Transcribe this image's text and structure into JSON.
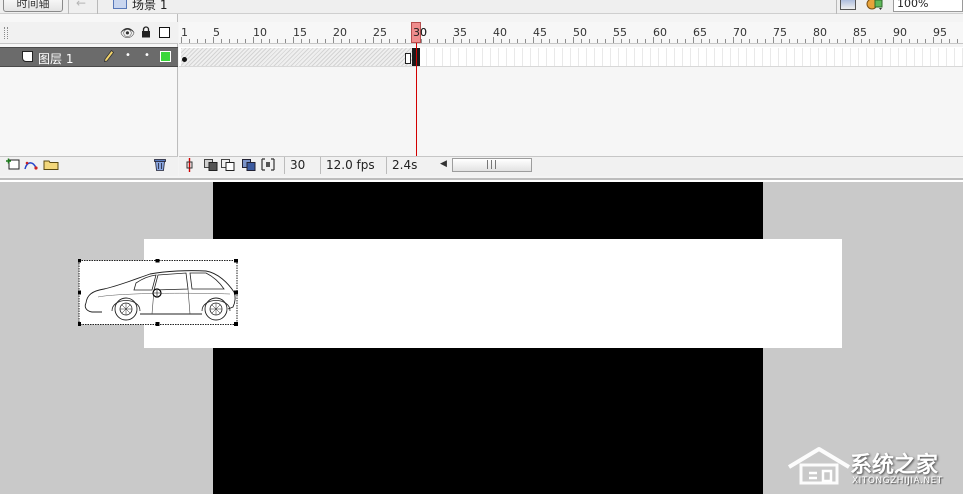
{
  "toolbar": {
    "timeline_button": "时间轴",
    "scene_label": "场景 1",
    "zoom": "100%"
  },
  "timeline": {
    "ruler_numbers": [
      "1",
      "5",
      "10",
      "15",
      "20",
      "25",
      "30",
      "35",
      "40",
      "45",
      "50",
      "55",
      "60",
      "65",
      "70",
      "75",
      "80",
      "85",
      "90",
      "95"
    ],
    "playhead_frame": "30",
    "layers": [
      {
        "name": "图层 1",
        "color": "#3ad63a"
      }
    ],
    "status": {
      "current_frame": "30",
      "frame_rate": "12.0 fps",
      "elapsed_time": "2.4s"
    }
  },
  "stage": {
    "background_color": "#000000",
    "workspace_color": "#c9c9c9",
    "banner_color": "#ffffff",
    "selected_symbol": "car-icon"
  },
  "watermark": {
    "title": "系统之家",
    "url": "XITONGZHIJIA.NET"
  }
}
